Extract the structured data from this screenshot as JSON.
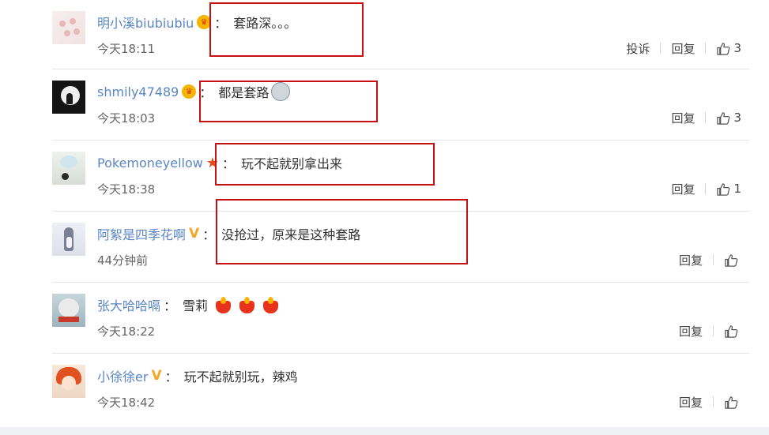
{
  "comments": [
    {
      "username": "明小溪biubiubiu",
      "badge": "crown-icon",
      "text": "套路深。。。",
      "time": "今天18:11",
      "report": "投诉",
      "reply": "回复",
      "likes": "3"
    },
    {
      "username": "shmily47489",
      "badge": "crown-icon",
      "text": "都是套路",
      "emoji": "husky-emoji-icon",
      "time": "今天18:03",
      "reply": "回复",
      "likes": "3"
    },
    {
      "username": "Pokemoneyellow",
      "badge": "star-icon",
      "text": "玩不起就别拿出来",
      "time": "今天18:38",
      "reply": "回复",
      "likes": "1"
    },
    {
      "username": "阿絮是四季花啊",
      "badge": "vip-v-icon",
      "text": "没抢过，原来是这种套路",
      "time": "44分钟前",
      "reply": "回复",
      "likes": ""
    },
    {
      "username": "张大哈哈嗝",
      "badge": "",
      "text": "雪莉",
      "emoji": "candle-icon",
      "time": "今天18:22",
      "reply": "回复",
      "likes": ""
    },
    {
      "username": "小徐徐er",
      "badge": "vip-v-icon",
      "text": "玩不起就别玩，辣鸡",
      "time": "今天18:42",
      "reply": "回复",
      "likes": ""
    }
  ],
  "colors": {
    "username": "#5a86c4",
    "highlight": "#c81010",
    "text": "#333333",
    "meta": "#666666"
  },
  "separator": "："
}
